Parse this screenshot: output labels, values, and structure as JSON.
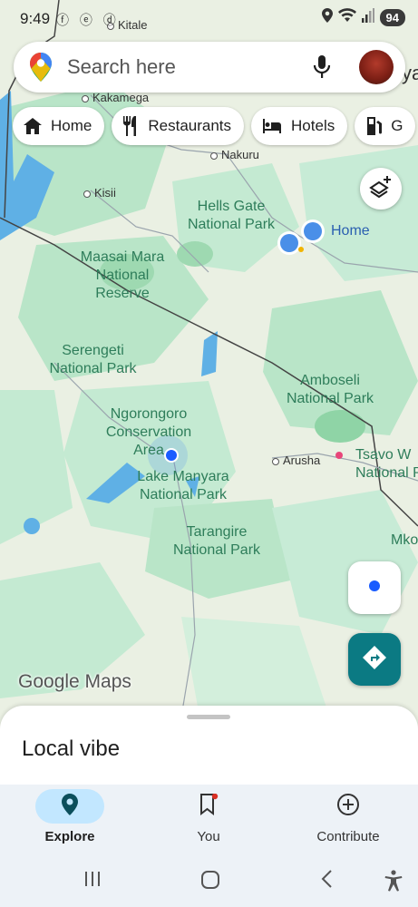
{
  "status_bar": {
    "time": "9:49",
    "notification_icons": "ⓕ ⓔ ⓓ",
    "battery": "94"
  },
  "search": {
    "placeholder": "Search here"
  },
  "chips": [
    {
      "label": "Home",
      "icon": "home-icon"
    },
    {
      "label": "Restaurants",
      "icon": "restaurant-icon"
    },
    {
      "label": "Hotels",
      "icon": "hotel-icon"
    },
    {
      "label": "G",
      "icon": "gas-station-icon"
    }
  ],
  "map": {
    "parks": {
      "hells_gate": "Hells Gate\nNational Park",
      "maasai_mara": "Maasai Mara\nNational\nReserve",
      "serengeti": "Serengeti\nNational Park",
      "amboseli": "Amboseli\nNational Park",
      "ngorongoro": "Ngorongoro\nConservation\nArea",
      "lake_manyara": "Lake Manyara\nNational Park",
      "tarangire": "Tarangire\nNational Park",
      "tsavo": "Tsavo W\nNational P",
      "mko": "Mko"
    },
    "cities": {
      "kitale": "Kitale",
      "kakamega": "Kakamega",
      "nakuru": "Nakuru",
      "kisii": "Kisii",
      "arusha": "Arusha",
      "partial_top_right": "ya"
    },
    "saved_home_label": "Home"
  },
  "google_maps_logo": "Google Maps",
  "sheet": {
    "title": "Local vibe"
  },
  "bottom_nav": [
    {
      "label": "Explore",
      "icon": "explore-pin-icon",
      "active": true
    },
    {
      "label": "You",
      "icon": "bookmark-icon",
      "active": false
    },
    {
      "label": "Contribute",
      "icon": "add-circle-icon",
      "active": false
    }
  ],
  "colors": {
    "accent": "#0b7a83",
    "active_pill": "#c2e7ff",
    "water": "#5fb0e5",
    "park": "#a8dfbf"
  }
}
